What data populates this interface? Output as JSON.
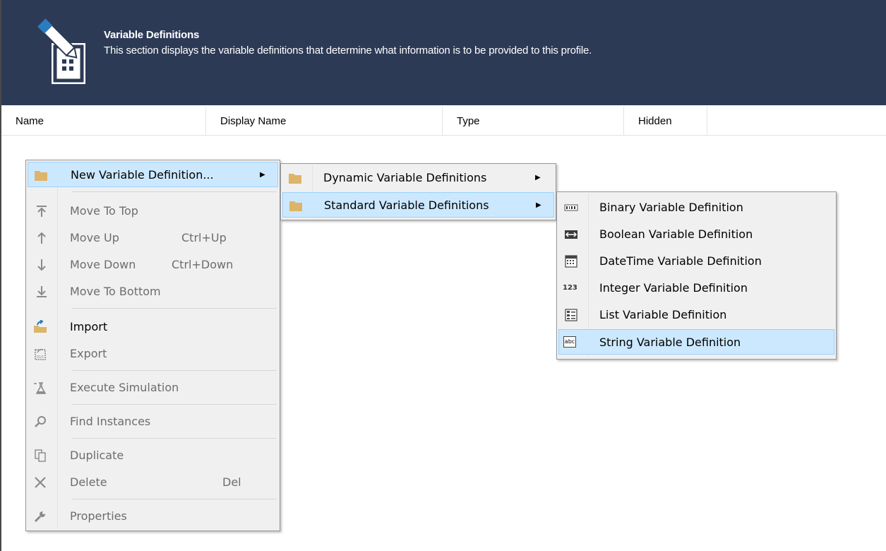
{
  "header": {
    "title": "Variable Definitions",
    "subtitle": "This section displays the variable definitions that determine what information is to be provided to this profile.",
    "icon": "variable-definitions-icon"
  },
  "columns": [
    "Name",
    "Display Name",
    "Type",
    "Hidden"
  ],
  "context_menu": {
    "new_variable": "New Variable Definition...",
    "move_to_top": "Move To Top",
    "move_up": "Move Up",
    "move_up_shortcut": "Ctrl+Up",
    "move_down": "Move Down",
    "move_down_shortcut": "Ctrl+Down",
    "move_to_bottom": "Move To Bottom",
    "import": "Import",
    "export": "Export",
    "execute_simulation": "Execute Simulation",
    "find_instances": "Find Instances",
    "duplicate": "Duplicate",
    "delete": "Delete",
    "delete_shortcut": "Del",
    "properties": "Properties"
  },
  "submenu1": {
    "dynamic": "Dynamic Variable Definitions",
    "standard": "Standard Variable Definitions"
  },
  "submenu2": {
    "binary": "Binary Variable Definition",
    "boolean": "Boolean Variable Definition",
    "datetime": "DateTime Variable Definition",
    "integer": "Integer Variable Definition",
    "integer_icon_text": "123",
    "list": "List Variable Definition",
    "string": "String Variable Definition",
    "string_icon_text": "abc"
  },
  "colors": {
    "header_bg": "#2c3a55",
    "menu_bg": "#f0f0f0",
    "highlight_bg": "#cce8ff",
    "highlight_border": "#99d1ff",
    "folder": "#dcb46a"
  }
}
